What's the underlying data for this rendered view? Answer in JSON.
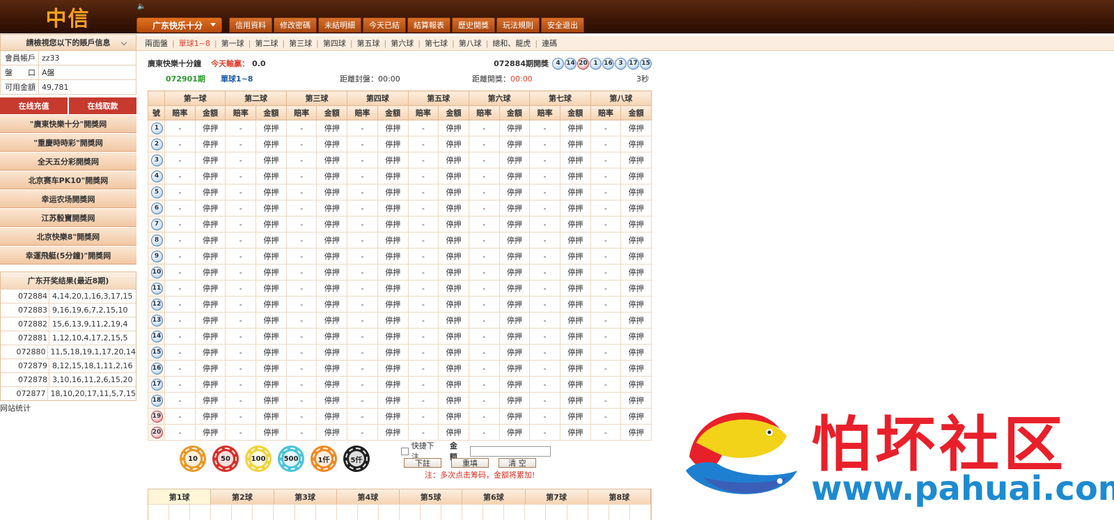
{
  "header": {
    "logo": "中信",
    "lottery_select": "广东快乐十分",
    "nav": [
      "信用資料",
      "修改密碼",
      "未結明細",
      "今天已結",
      "結算報表",
      "歷史開獎",
      "玩法規則",
      "安全退出"
    ]
  },
  "subnav": [
    "兩面盤",
    "單球1~8",
    "第一球",
    "第二球",
    "第三球",
    "第四球",
    "第五球",
    "第六球",
    "第七球",
    "第八球",
    "總和、龍虎",
    "連碼"
  ],
  "subnav_active_index": 1,
  "sidebar": {
    "account_header": "請檢視您以下的賬戶信息",
    "account": [
      {
        "k": "會員帳戶",
        "v": "zz33"
      },
      {
        "k": "盤　　口",
        "v": "A盤"
      },
      {
        "k": "可用金額",
        "v": "49,781"
      }
    ],
    "deposit": "在线充值",
    "withdraw": "在线取款",
    "links": [
      "\"廣東快樂十分\"開獎网",
      "\"重慶時時彩\"開獎网",
      "全天五分彩開獎网",
      "北京赛车PK10\"開獎网",
      "幸运农场開獎网",
      "江苏骰寶開獎网",
      "北京快樂8\"開獎网",
      "幸運飛艇(5分鐘)\"開獎网"
    ],
    "results_title": "广东开奖结果(最近8期)",
    "results": [
      {
        "p": "072884",
        "n": "4,14,20,1,16,3,17,15"
      },
      {
        "p": "072883",
        "n": "9,16,19,6,7,2,15,10"
      },
      {
        "p": "072882",
        "n": "15,6,13,9,11,2,19,4"
      },
      {
        "p": "072881",
        "n": "1,12,10,4,17,2,15,5"
      },
      {
        "p": "072880",
        "n": "11,5,18,19,1,17,20,14"
      },
      {
        "p": "072879",
        "n": "8,12,15,18,1,11,2,16"
      },
      {
        "p": "072878",
        "n": "3,10,16,11,2,6,15,20"
      },
      {
        "p": "072877",
        "n": "18,10,20,17,11,5,7,15"
      }
    ],
    "site_stats": "网站统计"
  },
  "main": {
    "game_name": "廣東快樂十分鐘",
    "today_win_label": "今天輸贏：",
    "today_win_value": "0.0",
    "last_draw_label": "072884期開獎",
    "last_draw_balls": [
      4,
      14,
      20,
      1,
      16,
      3,
      17,
      15
    ],
    "current_period": "072901期",
    "bet_type": "單球1~8",
    "close_label": "距離封盤：",
    "close_time": "00:00",
    "draw_label": "距離開獎：",
    "draw_time": "00:00",
    "refresh": "3秒",
    "ball_headers": [
      "第一球",
      "第二球",
      "第三球",
      "第四球",
      "第五球",
      "第六球",
      "第七球",
      "第八球"
    ],
    "col_no": "號",
    "col_odds": "賠率",
    "col_amount": "金額",
    "odds_value": "-",
    "amount_value": "停押",
    "numbers": [
      1,
      2,
      3,
      4,
      5,
      6,
      7,
      8,
      9,
      10,
      11,
      12,
      13,
      14,
      15,
      16,
      17,
      18,
      19,
      20
    ]
  },
  "chips": [
    "10",
    "50",
    "100",
    "500",
    "1仟",
    "5仟"
  ],
  "bet": {
    "quick": "快捷下注",
    "amount_label": "金额",
    "submit": "下註",
    "reset": "重填",
    "clear": "清 空",
    "note": "注：多次点击筹码，金额将累加!"
  },
  "bottom_tabs": [
    "第1球",
    "第2球",
    "第3球",
    "第4球",
    "第5球",
    "第6球",
    "第7球",
    "第8球"
  ],
  "watermark": {
    "text": "怕坏社区",
    "url": "www.pahuai.com"
  },
  "colors": {
    "header_bg": "#3a1505",
    "accent": "#e0701e",
    "red": "#c73a2e"
  }
}
